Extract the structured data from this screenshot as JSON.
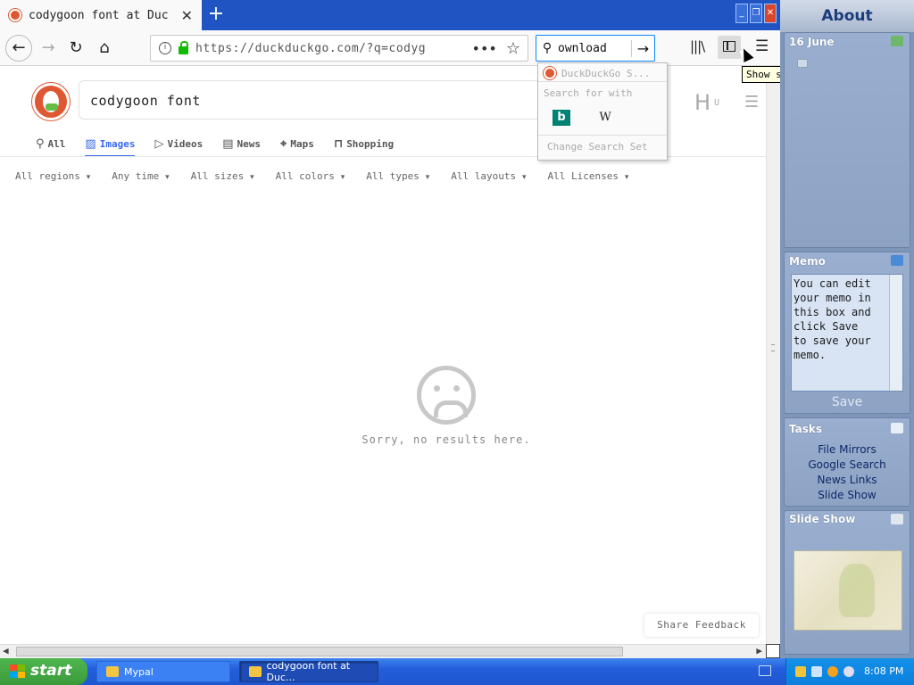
{
  "browser": {
    "tab_title": "codygoon font at Duc",
    "new_tab_icon": "plus-icon",
    "url": "https://duckduckgo.com/?q=codyg",
    "search_query": "ownload",
    "tooltip": "Show sidebars"
  },
  "search_dropdown": {
    "engine": "DuckDuckGo S...",
    "header": "Search for  with",
    "bing_label": "b",
    "wiki_label": "W",
    "change": "Change Search Set"
  },
  "page": {
    "query": "codygoon font",
    "brand_letter": "H",
    "brand_sub": "U",
    "tabs": [
      {
        "label": "All",
        "icon": "search-icon"
      },
      {
        "label": "Images",
        "icon": "image-icon"
      },
      {
        "label": "Videos",
        "icon": "play-icon"
      },
      {
        "label": "News",
        "icon": "news-icon"
      },
      {
        "label": "Maps",
        "icon": "map-pin-icon"
      },
      {
        "label": "Shopping",
        "icon": "shopping-bag-icon"
      }
    ],
    "active_tab": "Images",
    "filters": [
      "All regions",
      "Any time",
      "All sizes",
      "All colors",
      "All types",
      "All layouts",
      "All Licenses"
    ],
    "no_results": "Sorry, no results here.",
    "feedback": "Share Feedback"
  },
  "sidebar": {
    "title": "About",
    "date": "16 June",
    "memo_title": "Memo",
    "memo_text": "You can edit\nyour memo in\nthis box and\nclick Save\nto save your\nmemo.",
    "save": "Save",
    "tasks_title": "Tasks",
    "tasks": [
      "File Mirrors",
      "Google Search",
      "News Links",
      "Slide Show"
    ],
    "slideshow_title": "Slide Show"
  },
  "taskbar": {
    "start": "start",
    "items": [
      "Mypal",
      "codygoon font at Duc..."
    ],
    "clock": "8:08 PM"
  },
  "colors": {
    "ddg_orange": "#de5833",
    "active_blue": "#3969ef",
    "xp_taskbar": "#245edb"
  }
}
